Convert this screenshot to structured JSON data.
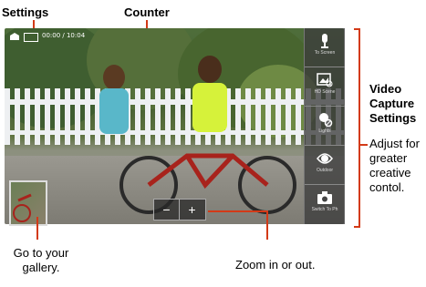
{
  "callouts": {
    "settings": "Settings",
    "counter": "Counter",
    "video_capture_title": "Video Capture Settings",
    "video_capture_desc": "Adjust for greater creative contol.",
    "gallery": "Go to your gallery.",
    "zoom": "Zoom in or out."
  },
  "status_bar": {
    "counter_text": "00:00 / 10:04"
  },
  "sidebar": {
    "items": [
      {
        "caption": "To Screen",
        "icon": "microphone-icon"
      },
      {
        "caption": "HD Scene",
        "icon": "scene-icon"
      },
      {
        "caption": "Lights",
        "icon": "light-icon"
      },
      {
        "caption": "Outdoor",
        "icon": "effects-icon"
      },
      {
        "caption": "Switch To Ph",
        "icon": "camera-switch-icon"
      }
    ]
  },
  "zoom": {
    "minus": "−",
    "plus": "+"
  },
  "colors": {
    "callout": "#d33a17"
  }
}
